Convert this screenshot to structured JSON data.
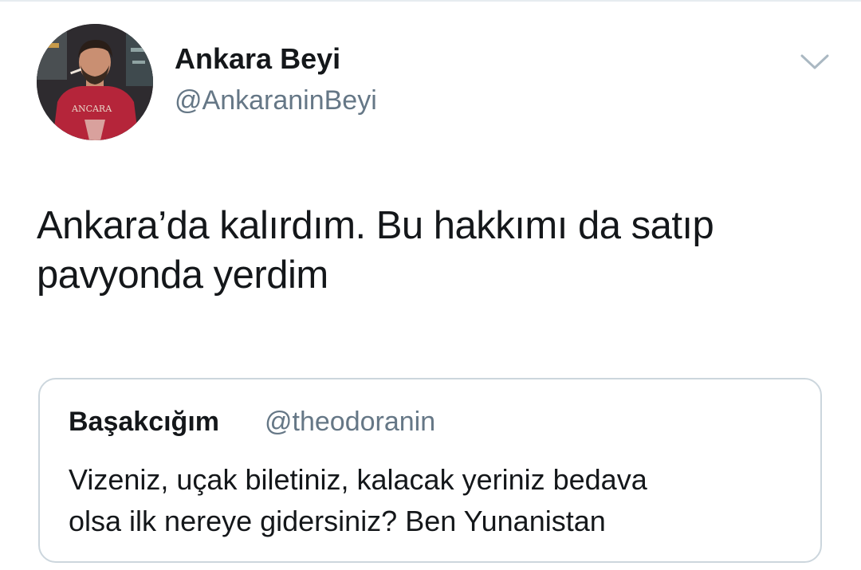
{
  "tweet": {
    "author": {
      "display_name": "Ankara Beyi",
      "handle": "@AnkaraninBeyi"
    },
    "text_lines": [
      "Ankara’da kalırdım. Bu hakkımı da satıp",
      "pavyonda yerdim"
    ],
    "menu_icon": "chevron-down-icon"
  },
  "quoted_tweet": {
    "display_name": "Başakcığım",
    "handle": "@theodoranin",
    "text_lines": [
      "Vizeniz, uçak biletiniz, kalacak yeriniz bedava",
      "olsa ilk nereye gidersiniz? Ben Yunanistan"
    ]
  },
  "colors": {
    "text_primary": "#14171a",
    "text_secondary": "#657786",
    "border": "#ccd6dd",
    "avatar_shirt": "#b5253a"
  }
}
